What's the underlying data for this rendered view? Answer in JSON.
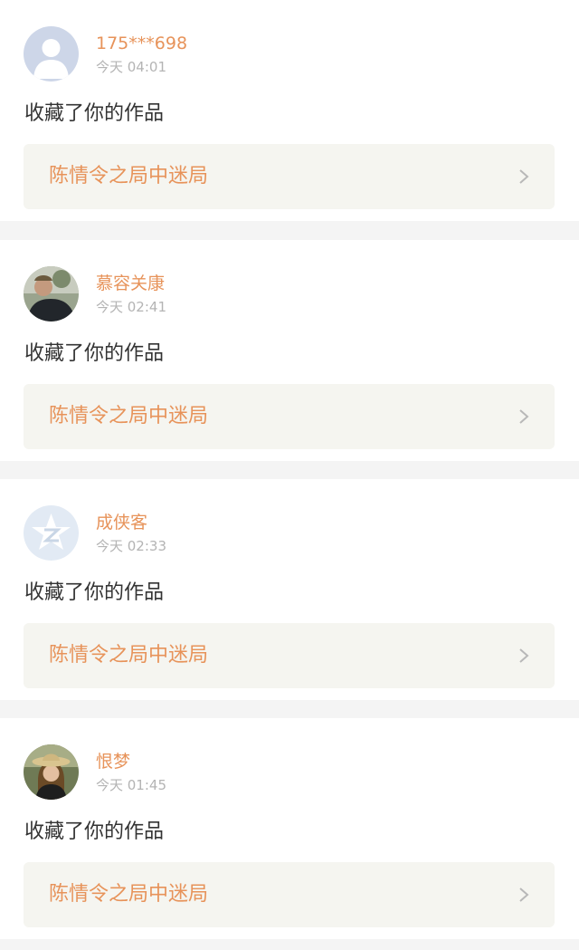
{
  "notifications": [
    {
      "username": "175***698",
      "time": "今天 04:01",
      "action": "收藏了你的作品",
      "work_title": "陈情令之局中迷局",
      "avatar": "default-person-avatar"
    },
    {
      "username": "慕容关康",
      "time": "今天 02:41",
      "action": "收藏了你的作品",
      "work_title": "陈情令之局中迷局",
      "avatar": "photo-man-avatar"
    },
    {
      "username": "成侠客",
      "time": "今天 02:33",
      "action": "收藏了你的作品",
      "work_title": "陈情令之局中迷局",
      "avatar": "qzone-star-avatar"
    },
    {
      "username": "恨梦",
      "time": "今天 01:45",
      "action": "收藏了你的作品",
      "work_title": "陈情令之局中迷局",
      "avatar": "photo-woman-hat-avatar"
    }
  ],
  "colors": {
    "accent": "#e7935a",
    "timestamp": "#b4b4b4",
    "body_text": "#333333",
    "work_box_bg": "#f5f5f0",
    "separator": "#f4f4f4"
  }
}
